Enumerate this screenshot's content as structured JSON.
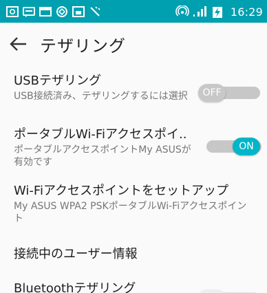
{
  "status_bar": {
    "left_icons": [
      "gallery-notification-icon",
      "message-notification-icon",
      "mail-notification-icon",
      "sync-notification-icon",
      "screenshot-notification-icon",
      "tool-notification-icon"
    ],
    "right_icons": [
      "hotspot-icon",
      "signal-icon",
      "battery-charging-icon"
    ],
    "time": "16:29",
    "background_color": "#00a0b0"
  },
  "app_bar": {
    "back_icon": "arrow-back-icon",
    "title": "テザリング"
  },
  "settings": {
    "usb_tethering": {
      "title": "USBテザリング",
      "summary": "USB接続済み、テザリングするには選択",
      "toggle_label": "OFF",
      "toggle_state": "off"
    },
    "portable_hotspot": {
      "title": "ポータブルWi-Fiアクセスポイ..",
      "summary": "ポータブルアクセスポイントMy ASUSが有効です",
      "toggle_label": "ON",
      "toggle_state": "on",
      "accent_color": "#00b6c8"
    },
    "hotspot_setup": {
      "title": "Wi-Fiアクセスポイントをセットアップ",
      "summary": "My ASUS WPA2 PSKポータブルWi-Fiアクセスポイント"
    },
    "connected_users": {
      "title": "接続中のユーザー情報"
    },
    "bluetooth_tethering": {
      "title": "Bluetoothテザリング"
    }
  }
}
